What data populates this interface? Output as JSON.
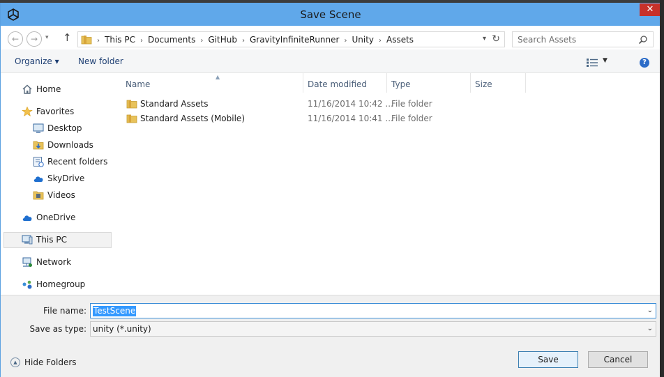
{
  "window": {
    "title": "Save Scene",
    "close_glyph": "✕"
  },
  "nav": {
    "back_glyph": "←",
    "forward_glyph": "→",
    "up_glyph": "↑",
    "breadcrumbs": [
      "This PC",
      "Documents",
      "GitHub",
      "GravityInfiniteRunner",
      "Unity",
      "Assets"
    ],
    "search_placeholder": "Search Assets"
  },
  "toolbar": {
    "organize_label": "Organize ▾",
    "new_folder_label": "New folder",
    "help_glyph": "?"
  },
  "sidebar": {
    "home": "Home",
    "favorites": "Favorites",
    "favorite_items": [
      "Desktop",
      "Downloads",
      "Recent folders",
      "SkyDrive",
      "Videos"
    ],
    "onedrive": "OneDrive",
    "this_pc": "This PC",
    "network": "Network",
    "homegroup": "Homegroup"
  },
  "columns": {
    "name": "Name",
    "date": "Date modified",
    "type": "Type",
    "size": "Size"
  },
  "files": [
    {
      "name": "Standard Assets",
      "date": "11/16/2014 10:42 ...",
      "type": "File folder"
    },
    {
      "name": "Standard Assets (Mobile)",
      "date": "11/16/2014 10:41 ...",
      "type": "File folder"
    }
  ],
  "bottom": {
    "file_name_label": "File name:",
    "file_name_value": "TestScene",
    "save_type_label": "Save as type:",
    "save_type_value": "unity (*.unity)",
    "hide_folders_label": "Hide Folders",
    "save_label": "Save",
    "cancel_label": "Cancel"
  },
  "colors": {
    "titlebar": "#60a8ea",
    "close": "#c7312a",
    "link_text": "#1e3f73",
    "selection": "#3399ff",
    "folder": "#e8c25a"
  }
}
